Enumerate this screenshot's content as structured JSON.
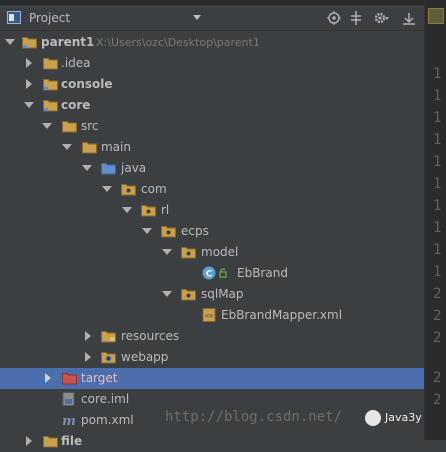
{
  "panel": {
    "title": "Project"
  },
  "tree": {
    "root": {
      "label": "parent1",
      "path": "X:\\Users\\ozc\\Desktop\\parent1"
    },
    "idea": {
      "label": ".idea"
    },
    "console": {
      "label": "console"
    },
    "core": {
      "label": "core"
    },
    "src": {
      "label": "src"
    },
    "main": {
      "label": "main"
    },
    "java": {
      "label": "java"
    },
    "com": {
      "label": "com"
    },
    "rl": {
      "label": "rl"
    },
    "ecps": {
      "label": "ecps"
    },
    "model": {
      "label": "model"
    },
    "ebbrand": {
      "label": "EbBrand"
    },
    "sqlmap": {
      "label": "sqlMap"
    },
    "mapper": {
      "label": "EbBrandMapper.xml"
    },
    "resources": {
      "label": "resources"
    },
    "webapp": {
      "label": "webapp"
    },
    "target": {
      "label": "target"
    },
    "coreiml": {
      "label": "core.iml"
    },
    "pom": {
      "label": "pom.xml"
    },
    "files": {
      "label": "file"
    }
  },
  "gutter": {
    "d1": "1",
    "d2": "2"
  },
  "watermark": {
    "text": "http://blog.csdn.net/"
  },
  "brand": {
    "name": "Java3y"
  },
  "colors": {
    "folder": "#c9a04c",
    "source_folder": "#5f8ecb",
    "selection": "#4b6eaf",
    "target": "#c75450"
  },
  "icons": [
    "project-icon",
    "dropdown-icon",
    "locate-icon",
    "collapse-icon",
    "gear-icon",
    "hide-icon",
    "folder-icon",
    "source-folder-icon",
    "package-icon",
    "class-icon",
    "xml-file-icon",
    "iml-file-icon",
    "maven-icon"
  ]
}
